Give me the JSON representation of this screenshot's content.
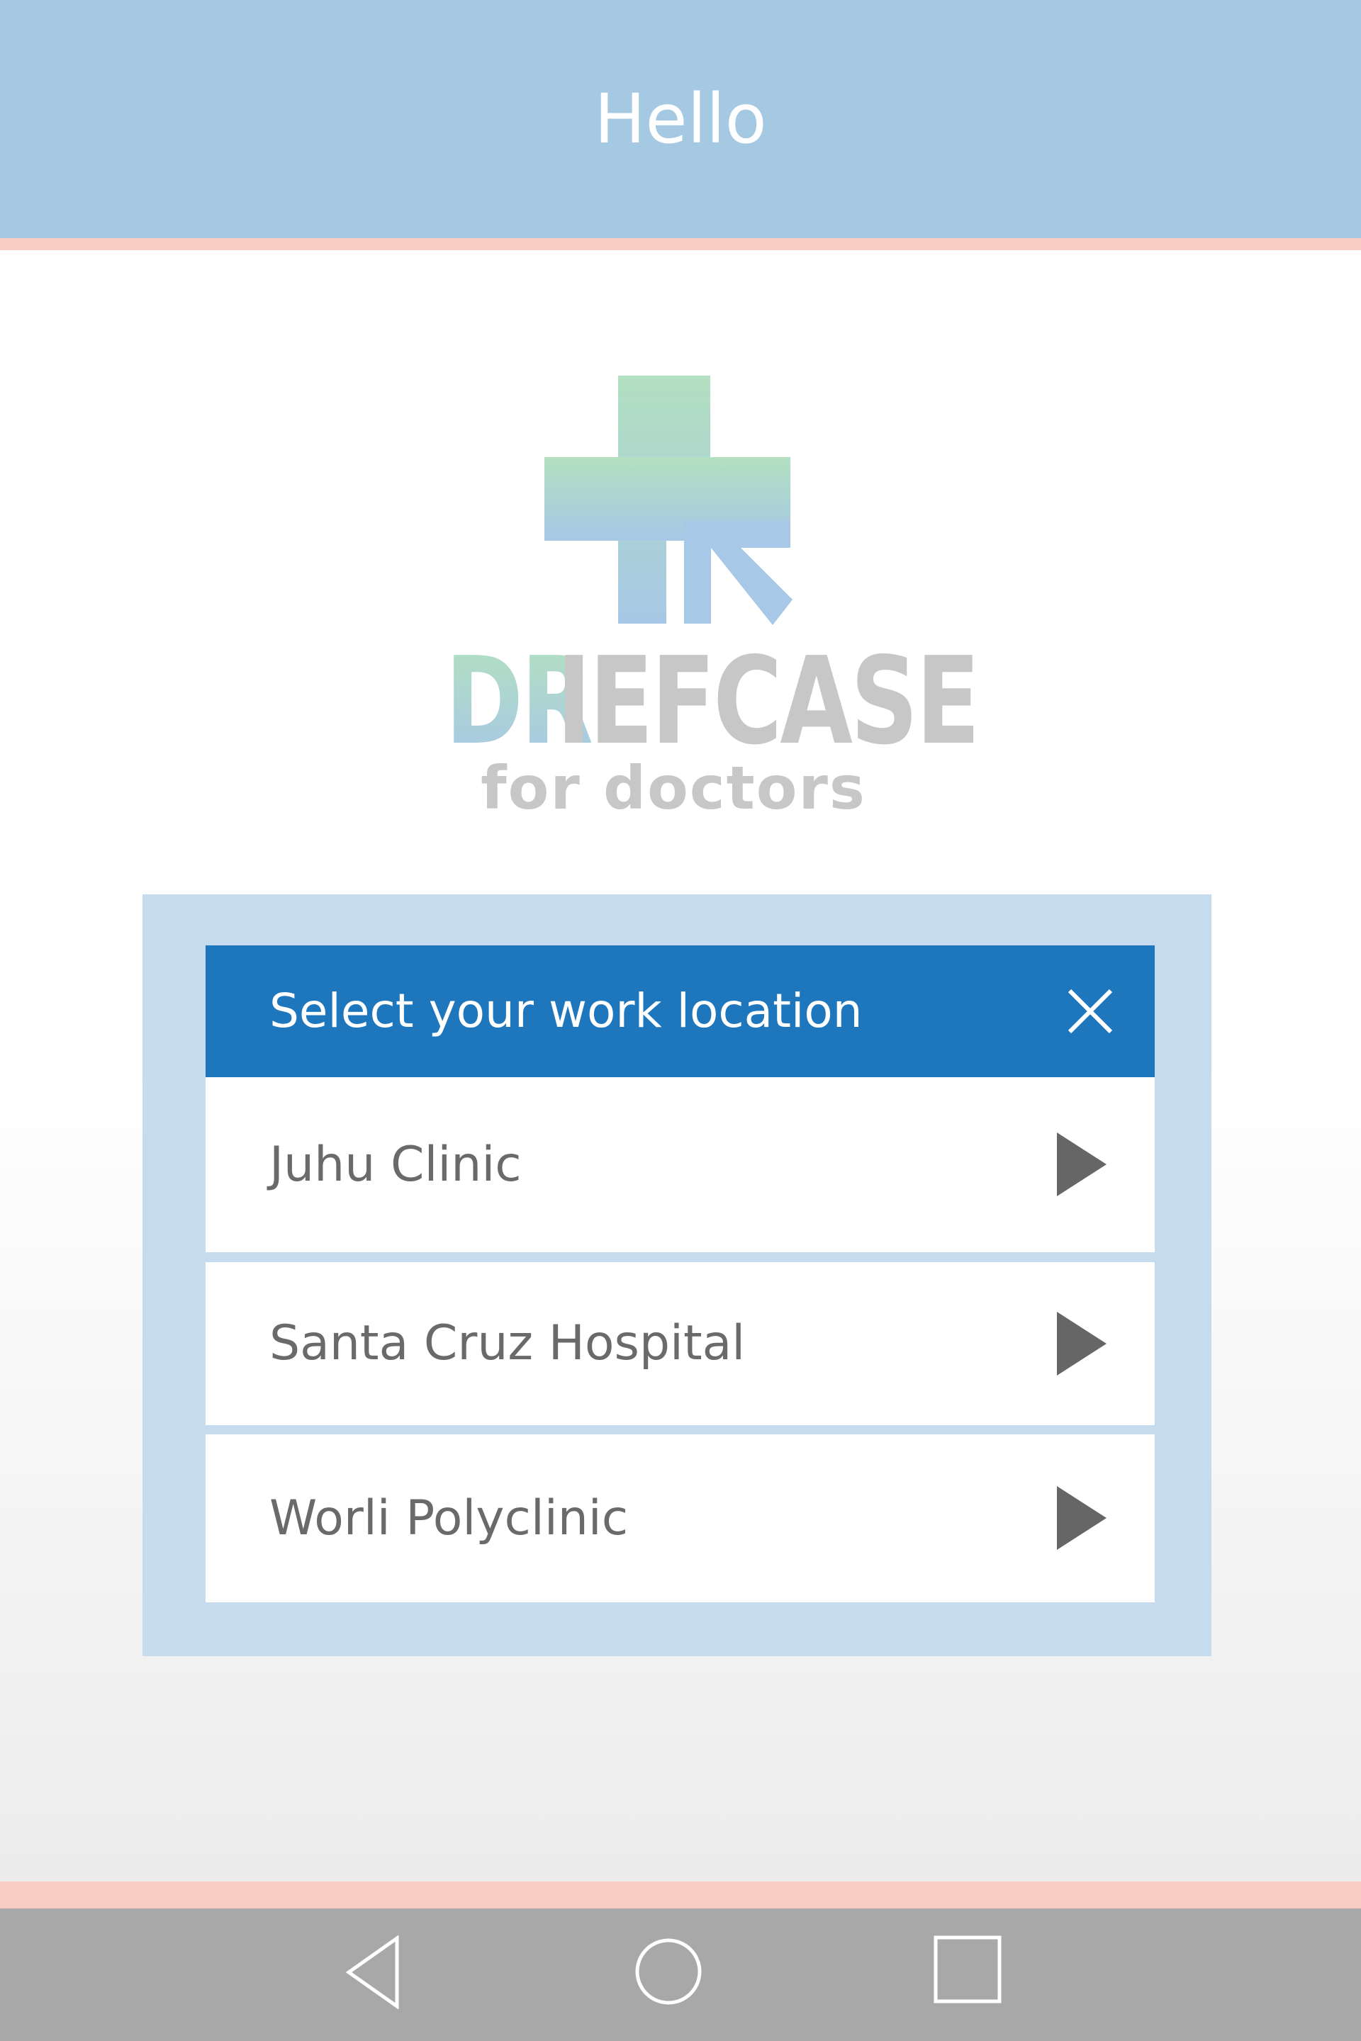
{
  "header": {
    "title": "Hello"
  },
  "brand": {
    "name_highlight": "DR",
    "name_rest": "IEFCASE",
    "tagline": "for doctors",
    "colors": {
      "cross_top": "#b2e0c0",
      "cross_bottom": "#a7c8e6",
      "text_gray": "#c7c7c7"
    }
  },
  "dialog": {
    "title": "Select your work location",
    "close_icon": "close-icon",
    "locations": [
      {
        "label": "Juhu Clinic",
        "icon": "play-arrow-icon"
      },
      {
        "label": "Santa Cruz Hospital",
        "icon": "play-arrow-icon"
      },
      {
        "label": "Worli Polyclinic",
        "icon": "play-arrow-icon"
      }
    ]
  },
  "navbar": {
    "back_icon": "back-triangle-icon",
    "home_icon": "home-circle-icon",
    "recents_icon": "recents-square-icon"
  },
  "colors": {
    "header_bg": "#a5c8e3",
    "accent_pink": "#f9cdc4",
    "dialog_header": "#1e76bd",
    "panel_bg": "#c7dbef",
    "navbar_bg": "#a9a8a9"
  }
}
